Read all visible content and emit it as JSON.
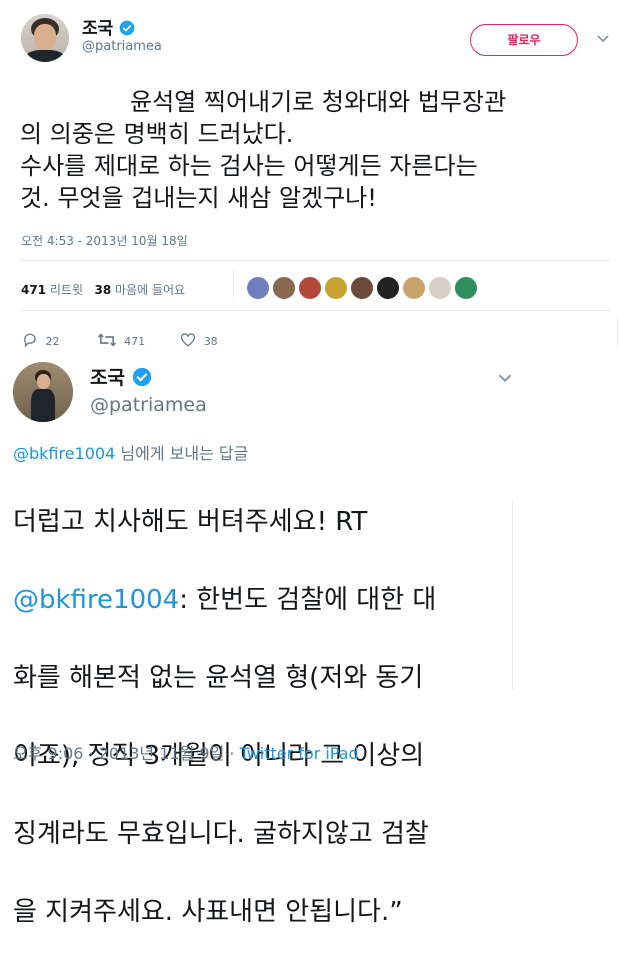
{
  "tweet1": {
    "author_name": "조국",
    "author_handle": "@patriamea",
    "follow_label": "팔로우",
    "text": "윤석열 찍어내기로 청와대와 법무장관의 의중은 명백히 드러났다.\n수사를 제대로 하는 검사는 어떻게든 자른다는 것. 무엇을 겁내는지 새삼 알겠구나!",
    "lines": [
      "윤석열 찍어내기로 청와대와 법무장관",
      "의 의중은 명백히 드러났다.",
      "수사를 제대로 하는 검사는 어떻게든 자른다는",
      "것. 무엇을 겁내는지 새삼 알겠구나!"
    ],
    "timestamp": "오전 4:53 - 2013년 10월 18일",
    "retweets_count": "471",
    "retweets_label": "리트윗",
    "likes_count": "38",
    "likes_label": "마음에 들어요",
    "actions": {
      "replies": "22",
      "retweets": "471",
      "likes": "38"
    },
    "liker_colors": [
      "#6f7fbf",
      "#8a6a4e",
      "#b4473a",
      "#c8a232",
      "#6b4a3a",
      "#222222",
      "#c9a46a",
      "#d8d0c4",
      "#2f8f5f"
    ]
  },
  "tweet2": {
    "author_name": "조국",
    "author_handle": "@patriamea",
    "reply_to_handle": "@bkfire1004",
    "reply_to_suffix": " 님에게 보내는 답글",
    "line1": "더럽고 치사해도 버텨주세요! RT",
    "mention": "@bkfire1004",
    "line2_rest": ": 한번도 검찰에 대한 대",
    "line3": "화를 해본적 없는 윤석열 형(저와 동기",
    "line4": "이죠), 정직 3개월이 아니라 그 이상의",
    "line5": "징계라도 무효입니다. 굴하지않고 검찰",
    "line6": "을 지켜주세요. 사표내면 안됩니다.”",
    "timestamp": "오후 9:06 · 2013년 11월 9일 · ",
    "source": "Twitter for iPad"
  },
  "colors": {
    "accent_blue": "#1b95e0",
    "follow_red": "#e0245e",
    "text_gray": "#657786"
  }
}
